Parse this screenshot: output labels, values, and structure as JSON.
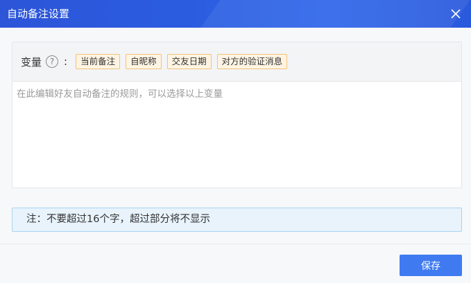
{
  "dialog": {
    "title": "自动备注设置",
    "close_icon": "close-icon"
  },
  "variables": {
    "label": "变量",
    "help_icon": "question-circle-icon",
    "help_glyph": "?",
    "colon": ":",
    "chips": [
      "当前备注",
      "自昵称",
      "交友日期",
      "对方的验证消息"
    ]
  },
  "editor": {
    "placeholder": "在此编辑好友自动备注的规则，可以选择以上变量",
    "value": ""
  },
  "note": {
    "text": "注：不要超过16个字，超过部分将不显示"
  },
  "footer": {
    "save_label": "保存"
  },
  "colors": {
    "title_bar": "#2c55d8",
    "chip_bg": "#fff4e3",
    "chip_border": "#f0c27a",
    "note_bg": "#e8f3fc",
    "note_border": "#a9d2ef",
    "primary_button": "#3f7af0"
  }
}
